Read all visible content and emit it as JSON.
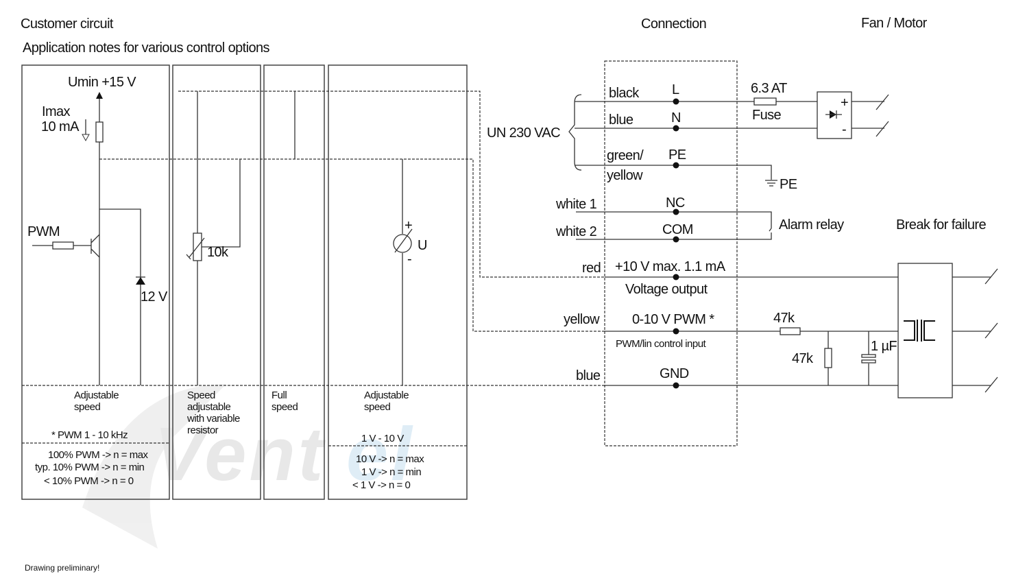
{
  "header": {
    "customer_circuit": "Customer circuit",
    "application_notes": "Application notes for various control options",
    "connection": "Connection",
    "fan_motor": "Fan / Motor"
  },
  "watermark": {
    "part1": "Vent",
    "part2": "el"
  },
  "panel_pwm": {
    "supply": "Umin +15 V",
    "imax": "Imax",
    "imax_value": "10 mA",
    "pwm": "PWM",
    "zener": "12 V",
    "mode_line1": "Adjustable",
    "mode_line2": "speed",
    "pwm_freq": "* PWM 1 - 10 kHz",
    "notes": [
      "100% PWM -> n = max",
      "typ. 10% PWM -> n = min",
      "< 10% PWM -> n = 0"
    ]
  },
  "panel_resistor": {
    "resistor": "10k",
    "mode_lines": [
      "Speed",
      "adjustable",
      "with variable",
      "resistor"
    ]
  },
  "panel_full": {
    "mode_lines": [
      "Full",
      "speed"
    ]
  },
  "panel_voltage": {
    "plus": "+",
    "minus": "-",
    "meter": "U",
    "mode_line1": "Adjustable",
    "mode_line2": "speed",
    "range": "1 V - 10 V",
    "notes": [
      "10 V -> n = max",
      "1 V -> n = min",
      "< 1 V -> n = 0"
    ]
  },
  "connection": {
    "supply": "UN 230 VAC",
    "wires": [
      {
        "color": "black",
        "terminal": "L"
      },
      {
        "color": "blue",
        "terminal": "N"
      },
      {
        "color": "green/",
        "color2": "yellow",
        "terminal": "PE"
      },
      {
        "color": "white 1",
        "terminal": "NC"
      },
      {
        "color": "white 2",
        "terminal": "COM"
      },
      {
        "color": "red",
        "terminal": "+10 V max. 1.1 mA",
        "description": "Voltage output"
      },
      {
        "color": "yellow",
        "terminal": "0-10 V  PWM *",
        "description": "PWM/lin control input"
      },
      {
        "color": "blue",
        "terminal": "GND"
      }
    ]
  },
  "motor": {
    "fuse_rating": "6.3 AT",
    "fuse": "Fuse",
    "rect_plus": "+",
    "rect_minus": "-",
    "pe": "PE",
    "alarm_relay": "Alarm relay",
    "break_for_failure": "Break for failure",
    "r_series": "47k",
    "r_shunt": "47k",
    "capacitor": "1 µF"
  },
  "footer": {
    "note": "Drawing preliminary!"
  }
}
